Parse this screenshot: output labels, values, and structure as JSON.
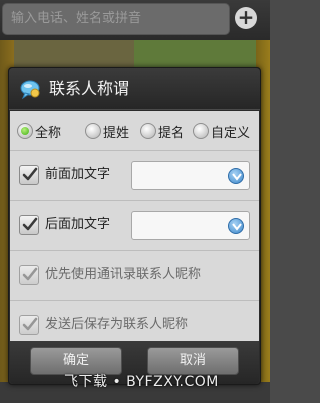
{
  "background": {
    "search_placeholder": "输入电话、姓名或拼音",
    "add_symbol": "+"
  },
  "dialog": {
    "title": "联系人称谓",
    "icon": "chat-bubble-icon",
    "radio_options": [
      {
        "label": "全称",
        "checked": true
      },
      {
        "label": "提姓",
        "checked": false
      },
      {
        "label": "提名",
        "checked": false
      },
      {
        "label": "自定义",
        "checked": false
      }
    ],
    "prefix": {
      "label": "前面加文字",
      "checked": true,
      "value": ""
    },
    "suffix": {
      "label": "后面加文字",
      "checked": true,
      "value": ""
    },
    "option_prefer_nickname": {
      "label": "优先使用通讯录联系人昵称",
      "checked": true,
      "enabled": false
    },
    "option_save_nickname": {
      "label": "发送后保存为联系人昵称",
      "checked": true,
      "enabled": false
    },
    "confirm_label": "确定",
    "cancel_label": "取消"
  },
  "watermark": "飞下载 • BYFZXY.COM",
  "colors": {
    "dialog_body": "#d9d9d9",
    "dialog_header": "#2b2b2b",
    "radio_selected": "#3fae14",
    "dropdown_accent": "#3d87c9"
  }
}
